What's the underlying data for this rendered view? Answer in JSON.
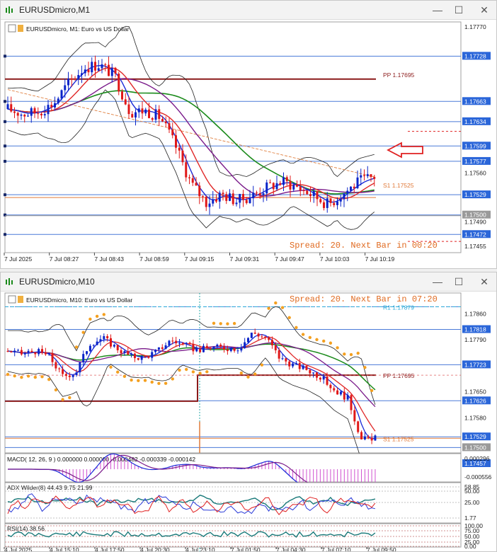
{
  "win1": {
    "title": "EURUSDmicro,M1",
    "symbol_label": "EURUSDmicro, M1:  Euro vs US Dollar",
    "spread_text": "Spread: 20. Next Bar in 00:20",
    "pp_label": "PP 1.17695",
    "s1_label": "S1 1.17525",
    "axis_prices": [
      "1.17770",
      "1.17728",
      "1.17695",
      "1.17663",
      "1.17634",
      "1.17599",
      "1.17577",
      "1.17560",
      "1.17529",
      "1.17525",
      "1.17500",
      "1.17490",
      "1.17472",
      "1.17455"
    ],
    "time_labels": [
      "7 Jul 2025",
      "7 Jul 08:27",
      "7 Jul 08:43",
      "7 Jul 08:59",
      "7 Jul 09:15",
      "7 Jul 09:31",
      "7 Jul 09:47",
      "7 Jul 10:03",
      "7 Jul 10:19"
    ]
  },
  "win2": {
    "title": "EURUSDmicro,M10",
    "symbol_label": "EURUSDmicro, M10:  Euro vs US Dollar",
    "spread_text": "Spread: 20. Next Bar in 07:20",
    "r1_label": "R1 1.17879",
    "pp_label": "PP 1.17695",
    "s1_label": "S1 1.17525",
    "axis_prices": [
      "1.17860",
      "1.17818",
      "1.17790",
      "1.17723",
      "1.17695",
      "1.17650",
      "1.17626",
      "1.17580",
      "1.17529",
      "1.17525",
      "1.17500",
      "1.17457"
    ],
    "macd_label": "MACD( 12, 26, 9 ) 0.000000 0.000000 -0.000482 -0.000339 -0.000142",
    "macd_axis": [
      "0.000296",
      "-0.000556"
    ],
    "adx_label": "ADX Wilder(8) 44.43 9.75 21.99",
    "adx_axis": [
      "58.85",
      "50.00",
      "25.00",
      "1.77"
    ],
    "rsi_label": "RSI(14) 38.56",
    "rsi_axis": [
      "100.00",
      "75.00",
      "50.00",
      "25.00",
      "0.00"
    ],
    "time_labels": [
      "4 Jul 2025",
      "4 Jul 15:10",
      "4 Jul 17:50",
      "4 Jul 20:30",
      "4 Jul 23:10",
      "7 Jul 01:50",
      "7 Jul 04:30",
      "7 Jul 07:10",
      "7 Jul 09:50"
    ]
  },
  "colors": {
    "bull": "#0a24c8",
    "bear": "#e01818",
    "ma_green": "#1a8a1a",
    "ma_purple": "#7a1a8a",
    "ma_red": "#e02828",
    "pivot": "#8b1a1a",
    "level_blue": "#4a7ad8",
    "label_bg": "#2b66d9",
    "sar": "#f4a020"
  }
}
